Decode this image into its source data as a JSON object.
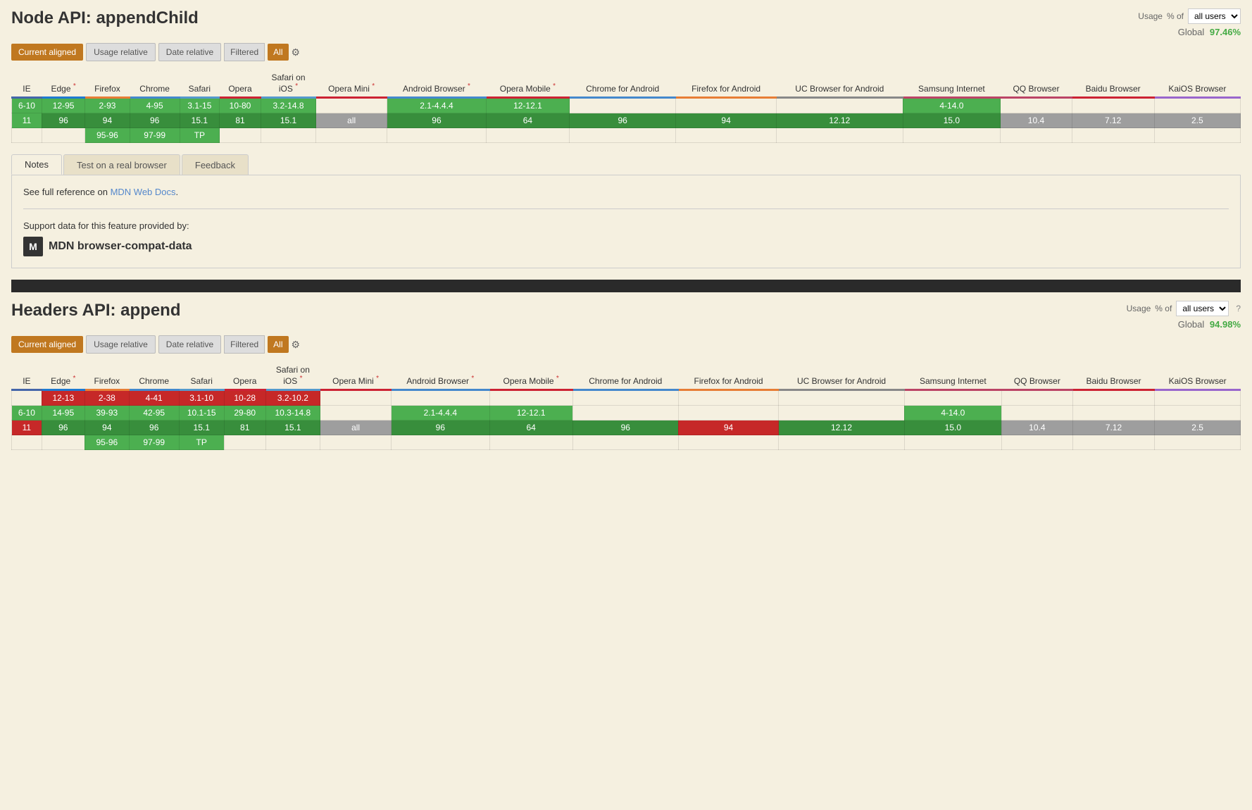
{
  "sections": [
    {
      "id": "appendChild",
      "title": "Node API: appendChild",
      "usage_label": "Usage",
      "usage_pct_label": "% of",
      "usage_select": "all users",
      "global_label": "Global",
      "global_value": "97.46%",
      "controls": {
        "current_aligned": "Current aligned",
        "usage_relative": "Usage relative",
        "date_relative": "Date relative",
        "filtered": "Filtered",
        "all": "All"
      },
      "browsers": [
        {
          "name": "IE",
          "class": "ie-col",
          "star": false
        },
        {
          "name": "Edge",
          "class": "edge-col",
          "star": true
        },
        {
          "name": "Firefox",
          "class": "firefox-col",
          "star": false
        },
        {
          "name": "Chrome",
          "class": "chrome-col",
          "star": false
        },
        {
          "name": "Safari",
          "class": "safari-col",
          "star": false
        },
        {
          "name": "Opera",
          "class": "opera-col",
          "star": false
        },
        {
          "name": "Safari on iOS",
          "class": "safari-ios-col",
          "star": true
        },
        {
          "name": "Opera Mini",
          "class": "opera-mini-col",
          "star": true
        },
        {
          "name": "Android Browser",
          "class": "android-col",
          "star": true
        },
        {
          "name": "Opera Mobile",
          "class": "opera-mob-col",
          "star": true
        },
        {
          "name": "Chrome for Android",
          "class": "chrome-android-col",
          "star": false
        },
        {
          "name": "Firefox for Android",
          "class": "firefox-android-col",
          "star": false
        },
        {
          "name": "UC Browser for Android",
          "class": "uc-android-col",
          "star": false
        },
        {
          "name": "Samsung Internet",
          "class": "samsung-col",
          "star": false
        },
        {
          "name": "QQ Browser",
          "class": "qq-col",
          "star": false
        },
        {
          "name": "Baidu Browser",
          "class": "baidu-col",
          "star": false
        },
        {
          "name": "KaiOS Browser",
          "class": "kaios-col",
          "star": false
        }
      ],
      "rows": [
        {
          "cells": [
            {
              "text": "6-10",
              "type": "cell-green"
            },
            {
              "text": "12-95",
              "type": "cell-green"
            },
            {
              "text": "2-93",
              "type": "cell-green"
            },
            {
              "text": "4-95",
              "type": "cell-green"
            },
            {
              "text": "3.1-15",
              "type": "cell-green"
            },
            {
              "text": "10-80",
              "type": "cell-green"
            },
            {
              "text": "3.2-14.8",
              "type": "cell-green"
            },
            {
              "text": "",
              "type": "cell-empty"
            },
            {
              "text": "2.1-4.4.4",
              "type": "cell-green"
            },
            {
              "text": "12-12.1",
              "type": "cell-green"
            },
            {
              "text": "",
              "type": "cell-empty"
            },
            {
              "text": "",
              "type": "cell-empty"
            },
            {
              "text": "",
              "type": "cell-empty"
            },
            {
              "text": "4-14.0",
              "type": "cell-green"
            },
            {
              "text": "",
              "type": "cell-empty"
            },
            {
              "text": "",
              "type": "cell-empty"
            },
            {
              "text": "",
              "type": "cell-empty"
            }
          ]
        },
        {
          "cells": [
            {
              "text": "11",
              "type": "cell-green"
            },
            {
              "text": "96",
              "type": "cell-dark-green"
            },
            {
              "text": "94",
              "type": "cell-dark-green"
            },
            {
              "text": "96",
              "type": "cell-dark-green"
            },
            {
              "text": "15.1",
              "type": "cell-dark-green"
            },
            {
              "text": "81",
              "type": "cell-dark-green"
            },
            {
              "text": "15.1",
              "type": "cell-dark-green"
            },
            {
              "text": "all",
              "type": "cell-gray"
            },
            {
              "text": "96",
              "type": "cell-dark-green"
            },
            {
              "text": "64",
              "type": "cell-dark-green"
            },
            {
              "text": "96",
              "type": "cell-dark-green"
            },
            {
              "text": "94",
              "type": "cell-dark-green"
            },
            {
              "text": "12.12",
              "type": "cell-dark-green"
            },
            {
              "text": "15.0",
              "type": "cell-dark-green"
            },
            {
              "text": "10.4",
              "type": "cell-gray"
            },
            {
              "text": "7.12",
              "type": "cell-gray"
            },
            {
              "text": "2.5",
              "type": "cell-gray"
            }
          ]
        },
        {
          "cells": [
            {
              "text": "",
              "type": "cell-empty"
            },
            {
              "text": "",
              "type": "cell-empty"
            },
            {
              "text": "95-96",
              "type": "cell-green"
            },
            {
              "text": "97-99",
              "type": "cell-green"
            },
            {
              "text": "TP",
              "type": "cell-green"
            },
            {
              "text": "",
              "type": "cell-empty"
            },
            {
              "text": "",
              "type": "cell-empty"
            },
            {
              "text": "",
              "type": "cell-empty"
            },
            {
              "text": "",
              "type": "cell-empty"
            },
            {
              "text": "",
              "type": "cell-empty"
            },
            {
              "text": "",
              "type": "cell-empty"
            },
            {
              "text": "",
              "type": "cell-empty"
            },
            {
              "text": "",
              "type": "cell-empty"
            },
            {
              "text": "",
              "type": "cell-empty"
            },
            {
              "text": "",
              "type": "cell-empty"
            },
            {
              "text": "",
              "type": "cell-empty"
            },
            {
              "text": "",
              "type": "cell-empty"
            }
          ]
        }
      ],
      "notes_tabs": [
        "Notes",
        "Test on a real browser",
        "Feedback"
      ],
      "active_tab": "Notes",
      "notes_text": "See full reference on ",
      "notes_link_text": "MDN Web Docs",
      "notes_link_url": "#",
      "notes_after": ".",
      "support_text": "Support data for this feature provided by:",
      "mdn_text": "MDN browser-compat-data"
    },
    {
      "id": "append",
      "title": "Headers API: append",
      "usage_label": "Usage",
      "usage_pct_label": "% of",
      "usage_select": "all users",
      "global_label": "Global",
      "global_value": "94.98%",
      "controls": {
        "current_aligned": "Current aligned",
        "usage_relative": "Usage relative",
        "date_relative": "Date relative",
        "filtered": "Filtered",
        "all": "All"
      },
      "browsers": [
        {
          "name": "IE",
          "class": "ie-col",
          "star": false
        },
        {
          "name": "Edge",
          "class": "edge-col",
          "star": true
        },
        {
          "name": "Firefox",
          "class": "firefox-col",
          "star": false
        },
        {
          "name": "Chrome",
          "class": "chrome-col",
          "star": false
        },
        {
          "name": "Safari",
          "class": "safari-col",
          "star": false
        },
        {
          "name": "Opera",
          "class": "opera-col",
          "star": false
        },
        {
          "name": "Safari on iOS",
          "class": "safari-ios-col",
          "star": true
        },
        {
          "name": "Opera Mini",
          "class": "opera-mini-col",
          "star": true
        },
        {
          "name": "Android Browser",
          "class": "android-col",
          "star": true
        },
        {
          "name": "Opera Mobile",
          "class": "opera-mob-col",
          "star": true
        },
        {
          "name": "Chrome for Android",
          "class": "chrome-android-col",
          "star": false
        },
        {
          "name": "Firefox for Android",
          "class": "firefox-android-col",
          "star": false
        },
        {
          "name": "UC Browser for Android",
          "class": "uc-android-col",
          "star": false
        },
        {
          "name": "Samsung Internet",
          "class": "samsung-col",
          "star": false
        },
        {
          "name": "QQ Browser",
          "class": "qq-col",
          "star": false
        },
        {
          "name": "Baidu Browser",
          "class": "baidu-col",
          "star": false
        },
        {
          "name": "KaiOS Browser",
          "class": "kaios-col",
          "star": false
        }
      ],
      "rows": [
        {
          "cells": [
            {
              "text": "",
              "type": "cell-empty"
            },
            {
              "text": "12-13",
              "type": "cell-red"
            },
            {
              "text": "2-38",
              "type": "cell-red"
            },
            {
              "text": "4-41",
              "type": "cell-red"
            },
            {
              "text": "3.1-10",
              "type": "cell-red"
            },
            {
              "text": "10-28",
              "type": "cell-red"
            },
            {
              "text": "3.2-10.2",
              "type": "cell-red"
            },
            {
              "text": "",
              "type": "cell-empty"
            },
            {
              "text": "",
              "type": "cell-empty"
            },
            {
              "text": "",
              "type": "cell-empty"
            },
            {
              "text": "",
              "type": "cell-empty"
            },
            {
              "text": "",
              "type": "cell-empty"
            },
            {
              "text": "",
              "type": "cell-empty"
            },
            {
              "text": "",
              "type": "cell-empty"
            },
            {
              "text": "",
              "type": "cell-empty"
            },
            {
              "text": "",
              "type": "cell-empty"
            },
            {
              "text": "",
              "type": "cell-empty"
            }
          ]
        },
        {
          "cells": [
            {
              "text": "6-10",
              "type": "cell-green"
            },
            {
              "text": "14-95",
              "type": "cell-green"
            },
            {
              "text": "39-93",
              "type": "cell-green"
            },
            {
              "text": "42-95",
              "type": "cell-green"
            },
            {
              "text": "10.1-15",
              "type": "cell-green"
            },
            {
              "text": "29-80",
              "type": "cell-green"
            },
            {
              "text": "10.3-14.8",
              "type": "cell-green"
            },
            {
              "text": "",
              "type": "cell-empty"
            },
            {
              "text": "2.1-4.4.4",
              "type": "cell-green"
            },
            {
              "text": "12-12.1",
              "type": "cell-green"
            },
            {
              "text": "",
              "type": "cell-empty"
            },
            {
              "text": "",
              "type": "cell-empty"
            },
            {
              "text": "",
              "type": "cell-empty"
            },
            {
              "text": "4-14.0",
              "type": "cell-green"
            },
            {
              "text": "",
              "type": "cell-empty"
            },
            {
              "text": "",
              "type": "cell-empty"
            },
            {
              "text": "",
              "type": "cell-empty"
            }
          ]
        },
        {
          "cells": [
            {
              "text": "11",
              "type": "cell-red"
            },
            {
              "text": "96",
              "type": "cell-dark-green"
            },
            {
              "text": "94",
              "type": "cell-dark-green"
            },
            {
              "text": "96",
              "type": "cell-dark-green"
            },
            {
              "text": "15.1",
              "type": "cell-dark-green"
            },
            {
              "text": "81",
              "type": "cell-dark-green"
            },
            {
              "text": "15.1",
              "type": "cell-dark-green"
            },
            {
              "text": "all",
              "type": "cell-gray"
            },
            {
              "text": "96",
              "type": "cell-dark-green"
            },
            {
              "text": "64",
              "type": "cell-dark-green"
            },
            {
              "text": "96",
              "type": "cell-dark-green"
            },
            {
              "text": "94",
              "type": "cell-red"
            },
            {
              "text": "12.12",
              "type": "cell-dark-green"
            },
            {
              "text": "15.0",
              "type": "cell-dark-green"
            },
            {
              "text": "10.4",
              "type": "cell-gray"
            },
            {
              "text": "7.12",
              "type": "cell-gray"
            },
            {
              "text": "2.5",
              "type": "cell-gray"
            }
          ]
        },
        {
          "cells": [
            {
              "text": "",
              "type": "cell-empty"
            },
            {
              "text": "",
              "type": "cell-empty"
            },
            {
              "text": "95-96",
              "type": "cell-green"
            },
            {
              "text": "97-99",
              "type": "cell-green"
            },
            {
              "text": "TP",
              "type": "cell-green"
            },
            {
              "text": "",
              "type": "cell-empty"
            },
            {
              "text": "",
              "type": "cell-empty"
            },
            {
              "text": "",
              "type": "cell-empty"
            },
            {
              "text": "",
              "type": "cell-empty"
            },
            {
              "text": "",
              "type": "cell-empty"
            },
            {
              "text": "",
              "type": "cell-empty"
            },
            {
              "text": "",
              "type": "cell-empty"
            },
            {
              "text": "",
              "type": "cell-empty"
            },
            {
              "text": "",
              "type": "cell-empty"
            },
            {
              "text": "",
              "type": "cell-empty"
            },
            {
              "text": "",
              "type": "cell-empty"
            },
            {
              "text": "",
              "type": "cell-empty"
            }
          ]
        }
      ]
    }
  ]
}
